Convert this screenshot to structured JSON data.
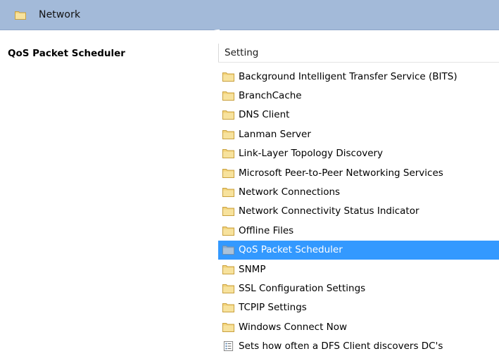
{
  "header": {
    "title": "Network",
    "icon": "folder-icon"
  },
  "left_pane": {
    "title": "QoS Packet Scheduler"
  },
  "table": {
    "column_header": "Setting",
    "rows": [
      {
        "label": "Background Intelligent Transfer Service (BITS)",
        "icon": "folder-icon",
        "selected": false
      },
      {
        "label": "BranchCache",
        "icon": "folder-icon",
        "selected": false
      },
      {
        "label": "DNS Client",
        "icon": "folder-icon",
        "selected": false
      },
      {
        "label": "Lanman Server",
        "icon": "folder-icon",
        "selected": false
      },
      {
        "label": "Link-Layer Topology Discovery",
        "icon": "folder-icon",
        "selected": false
      },
      {
        "label": "Microsoft Peer-to-Peer Networking Services",
        "icon": "folder-icon",
        "selected": false
      },
      {
        "label": "Network Connections",
        "icon": "folder-icon",
        "selected": false
      },
      {
        "label": "Network Connectivity Status Indicator",
        "icon": "folder-icon",
        "selected": false
      },
      {
        "label": "Offline Files",
        "icon": "folder-icon",
        "selected": false
      },
      {
        "label": "QoS Packet Scheduler",
        "icon": "folder-icon",
        "selected": true
      },
      {
        "label": "SNMP",
        "icon": "folder-icon",
        "selected": false
      },
      {
        "label": "SSL Configuration Settings",
        "icon": "folder-icon",
        "selected": false
      },
      {
        "label": "TCPIP Settings",
        "icon": "folder-icon",
        "selected": false
      },
      {
        "label": "Windows Connect Now",
        "icon": "folder-icon",
        "selected": false
      },
      {
        "label": "Sets how often a DFS Client discovers DC's",
        "icon": "policy-setting-icon",
        "selected": false
      }
    ]
  },
  "colors": {
    "header_band": "#a3bad9",
    "selection": "#3399ff",
    "folder": "#f3d37a",
    "folder_selected": "#8faecc"
  }
}
